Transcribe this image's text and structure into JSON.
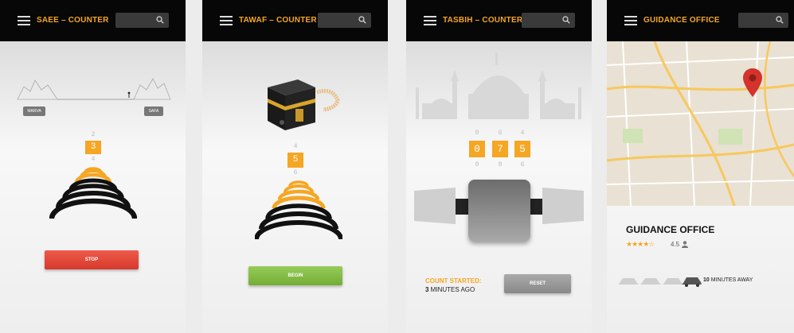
{
  "saee": {
    "title": "SAEE – COUNTER",
    "left_label": "MARVA",
    "right_label": "SAFA",
    "digit_above": "2",
    "count": "3",
    "digit_below": "4",
    "button": "STOP"
  },
  "tawaf": {
    "title": "TAWAF – COUNTER",
    "digit_above": "4",
    "count": "5",
    "digit_below": "6",
    "button": "BEGIN"
  },
  "tasbih": {
    "title": "TASBIH – COUNTER",
    "digits_above": [
      "0",
      "6",
      "4"
    ],
    "digits": [
      "0",
      "7",
      "5"
    ],
    "digits_below": [
      "0",
      "8",
      "6"
    ],
    "status_label": "COUNT STARTED:",
    "status_value_bold": "3",
    "status_value_rest": " MINUTES AGO",
    "button": "RESET"
  },
  "guidance": {
    "title": "GUIDANCE OFFICE",
    "place_name": "GUIDANCE OFFICE",
    "rating": "4.5",
    "stars_filled": 4.5,
    "away_bold": "10",
    "away_rest": " MINUTES AWAY"
  },
  "colors": {
    "accent": "#f5a623",
    "header": "#070707",
    "stop": "#e0463a",
    "begin": "#84bd47",
    "pin": "#d3332b"
  }
}
